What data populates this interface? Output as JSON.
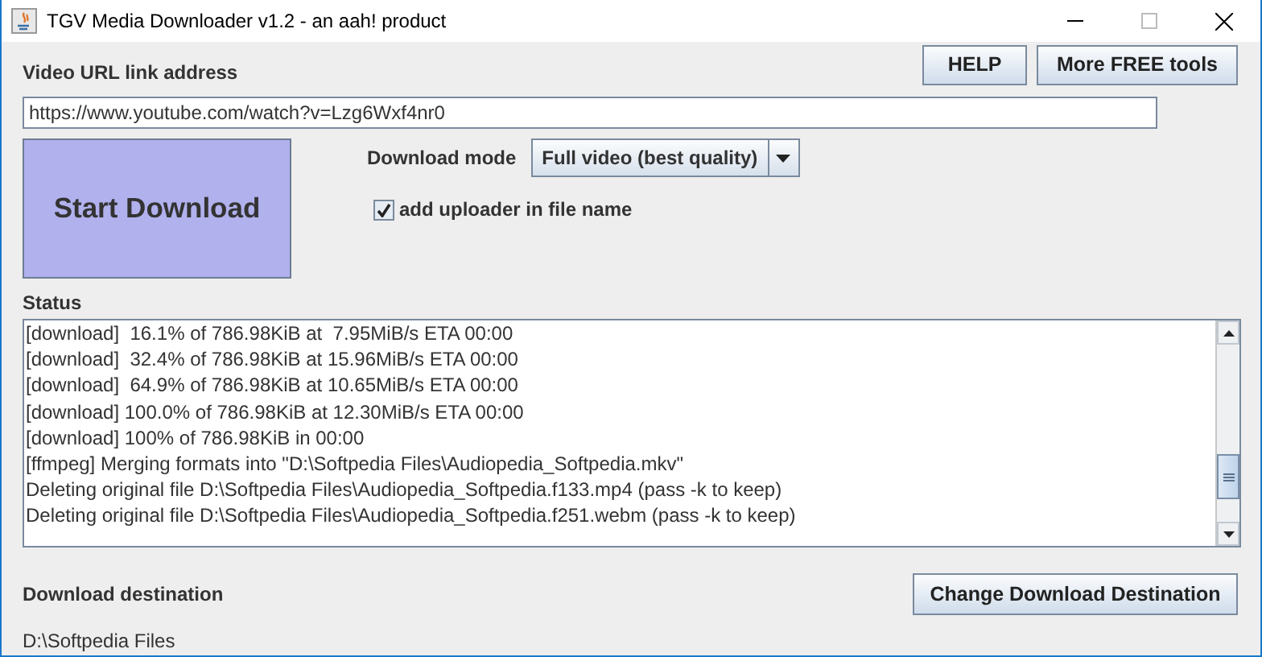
{
  "window": {
    "title": "TGV Media Downloader v1.2 - an aah! product"
  },
  "url_label": "Video URL link address",
  "top_buttons": [
    "HELP",
    "More FREE tools"
  ],
  "url_field": {
    "value": "https://www.youtube.com/watch?v=Lzg6Wxf4nr0"
  },
  "start_button": "Start Download",
  "download_mode": {
    "label": "Download mode",
    "value": "Full video (best quality)"
  },
  "uploader_option": {
    "label": "add uploader in file name",
    "checked": true
  },
  "status": {
    "label": "Status",
    "lines": [
      "[download]  16.1% of 786.98KiB at  7.95MiB/s ETA 00:00",
      "[download]  32.4% of 786.98KiB at 15.96MiB/s ETA 00:00",
      "[download]  64.9% of 786.98KiB at 10.65MiB/s ETA 00:00",
      "[download] 100.0% of 786.98KiB at 12.30MiB/s ETA 00:00",
      "[download] 100% of 786.98KiB in 00:00",
      "[ffmpeg] Merging formats into \"D:\\Softpedia Files\\Audiopedia_Softpedia.mkv\"",
      "Deleting original file D:\\Softpedia Files\\Audiopedia_Softpedia.f133.mp4 (pass -k to keep)",
      "Deleting original file D:\\Softpedia Files\\Audiopedia_Softpedia.f251.webm (pass -k to keep)"
    ]
  },
  "destination": {
    "label": "Download destination",
    "button": "Change Download Destination",
    "path": "D:\\Softpedia Files"
  }
}
